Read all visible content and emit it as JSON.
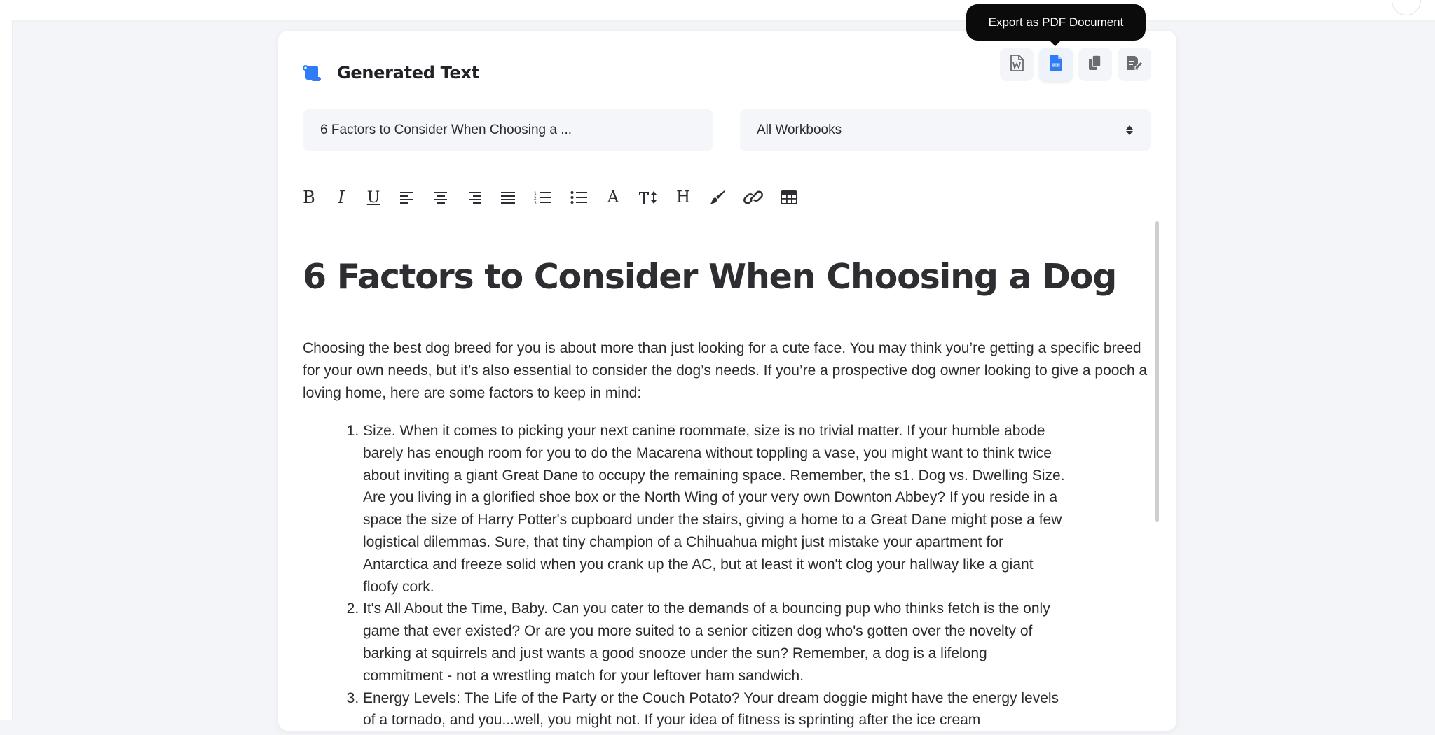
{
  "tooltip": {
    "text": "Export as PDF Document"
  },
  "card": {
    "title": "Generated Text",
    "icon": "scroll-icon"
  },
  "actions": [
    {
      "name": "export-word-button",
      "icon": "word-doc-icon"
    },
    {
      "name": "export-pdf-button",
      "icon": "pdf-doc-icon",
      "active": true
    },
    {
      "name": "copy-button",
      "icon": "copy-icon"
    },
    {
      "name": "edit-document-button",
      "icon": "edit-doc-icon"
    }
  ],
  "fields": {
    "title_value": "6 Factors to Consider When Choosing a ...",
    "workbook_selected": "All Workbooks"
  },
  "toolbar": {
    "items": [
      "bold-icon",
      "italic-icon",
      "underline-icon",
      "align-left-icon",
      "align-center-icon",
      "align-right-icon",
      "align-justify-icon",
      "ordered-list-icon",
      "unordered-list-icon",
      "font-color-icon",
      "font-size-icon",
      "heading-icon",
      "highlight-brush-icon",
      "link-icon",
      "table-icon"
    ],
    "labels": {
      "bold": "B",
      "italic": "I",
      "underline": "U",
      "font": "A",
      "heading": "H"
    }
  },
  "document": {
    "title": "6 Factors to Consider When Choosing a Dog",
    "intro": "Choosing the best dog breed for you is about more than just looking for a cute face. You may think you’re getting a specific breed for your own needs, but it’s also essential to consider the dog’s needs. If you’re a prospective dog owner looking to give a pooch a loving home, here are some factors to keep in mind:",
    "items": [
      "Size. When it comes to picking your next canine roommate, size is no trivial matter. If your humble abode barely has enough room for you to do the Macarena without toppling a vase, you might want to think twice about inviting a giant Great Dane to occupy the remaining space. Remember, the s1. Dog vs. Dwelling Size. Are you living in a glorified shoe box or the North Wing of your very own Downton Abbey? If you reside in a space the size of Harry Potter's cupboard under the stairs, giving a home to a Great Dane might pose a few logistical dilemmas. Sure, that tiny champion of a Chihuahua might just mistake your apartment for Antarctica and freeze solid when you crank up the AC, but at least it won't clog your hallway like a giant floofy cork.",
      " It's All About the Time, Baby. Can you cater to the demands of a bouncing pup who thinks fetch is the only game that ever existed? Or are you more suited to a senior citizen dog who's gotten over the novelty of barking at squirrels and just wants a good snooze under the sun? Remember, a dog is a lifelong commitment - not a wrestling match for your leftover ham sandwich.",
      "Energy Levels: The Life of the Party or the Couch Potato? Your dream doggie might have the energy levels of a tornado, and you...well, you might not. If your idea of fitness is sprinting after the ice cream"
    ]
  },
  "colors": {
    "accent": "#2f7cf6",
    "icon_gray": "#6b6b70",
    "tooltip_bg": "#0b0b0b"
  }
}
